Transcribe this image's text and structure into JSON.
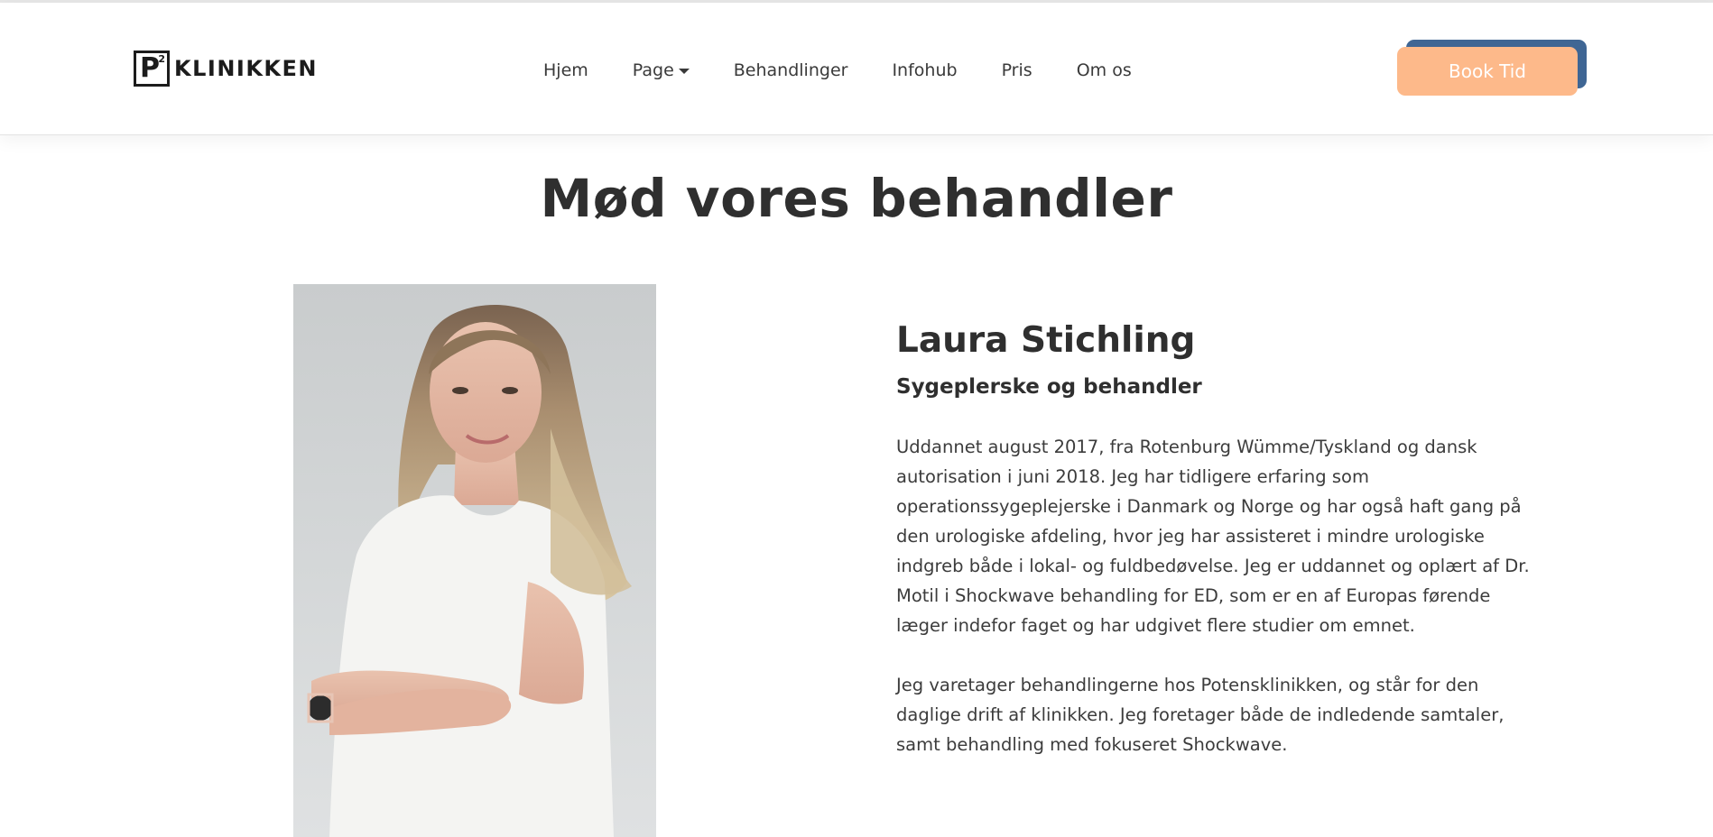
{
  "brand": {
    "logo_letter": "P",
    "logo_superscript": "2",
    "logo_text": "KLINIKKEN"
  },
  "nav": {
    "items": [
      {
        "label": "Hjem",
        "dropdown": false
      },
      {
        "label": "Page",
        "dropdown": true
      },
      {
        "label": "Behandlinger",
        "dropdown": false
      },
      {
        "label": "Infohub",
        "dropdown": false
      },
      {
        "label": "Pris",
        "dropdown": false
      },
      {
        "label": "Om os",
        "dropdown": false
      }
    ],
    "cta_label": "Book Tid"
  },
  "page": {
    "title": "Mød vores behandler"
  },
  "profile": {
    "name": "Laura Stichling",
    "role": "Sygeplerske og behandler",
    "paragraphs": [
      "Uddannet august 2017, fra Rotenburg Wümme/Tyskland og dansk autorisation i juni 2018. Jeg har tidligere erfaring som operationssygeplejerske i Danmark og Norge og har også haft gang på den urologiske afdeling, hvor jeg har assisteret i mindre urologiske indgreb både i lokal- og fuldbedøvelse. Jeg er uddannet og oplært af Dr. Motil i Shockwave behandling for ED, som er en af Europas førende læger indefor faget og har udgivet flere studier om emnet.",
      "Jeg varetager behandlingerne hos Potensklinikken, og står for den daglige drift af klinikken. Jeg foretager både de indledende samtaler, samt behandling med fokuseret Shockwave."
    ]
  },
  "colors": {
    "cta_background": "#fdb98a",
    "cta_shadow": "#3f6694",
    "text_dark": "#2f2f2f"
  }
}
